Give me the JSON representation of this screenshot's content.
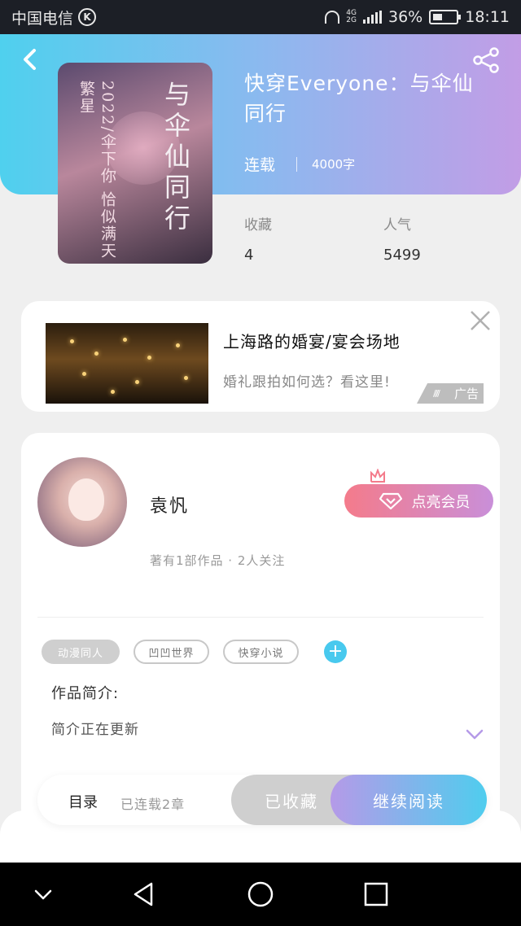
{
  "status_bar": {
    "carrier": "中国电信",
    "carrier_badge": "K",
    "network_top": "4G",
    "network_bottom": "2G",
    "battery": "36%",
    "time": "18:11"
  },
  "book": {
    "title": "快穿Everyone：与伞仙同行",
    "cover_title": "与伞仙同行",
    "cover_sub": "2022/伞下你 恰似满天繁星",
    "status": "连载",
    "word_count": "4000字",
    "stats": [
      {
        "label": "收藏",
        "value": "4"
      },
      {
        "label": "人气",
        "value": "5499"
      }
    ]
  },
  "ad": {
    "title": "上海路的婚宴/宴会场地",
    "desc": "婚礼跟拍如何选？看这里!",
    "badge": "广告"
  },
  "author": {
    "name": "袁忛",
    "meta": "著有1部作品 · 2人关注",
    "vip_label": "点亮会员"
  },
  "tags": [
    "动漫同人",
    "凹凹世界",
    "快穿小说"
  ],
  "intro": {
    "label": "作品简介:",
    "text": "简介正在更新"
  },
  "actions": {
    "toc": "目录",
    "chapters": "已连载2章",
    "collected": "已收藏",
    "continue": "继续阅读"
  },
  "colors": {
    "header_gradient": [
      "#4fd0ee",
      "#c29de6"
    ],
    "vip_gradient": [
      "#f47b8b",
      "#c98fd9"
    ],
    "continue_gradient": [
      "#b59ae8",
      "#4fcdee"
    ],
    "accent_blue": "#48c9ee"
  },
  "icons": [
    "back-arrow-icon",
    "share-icon",
    "close-icon",
    "diamond-icon",
    "crown-icon",
    "plus-icon",
    "chevron-down-icon",
    "nav-down-icon",
    "nav-back-icon",
    "nav-home-icon",
    "nav-recents-icon"
  ]
}
